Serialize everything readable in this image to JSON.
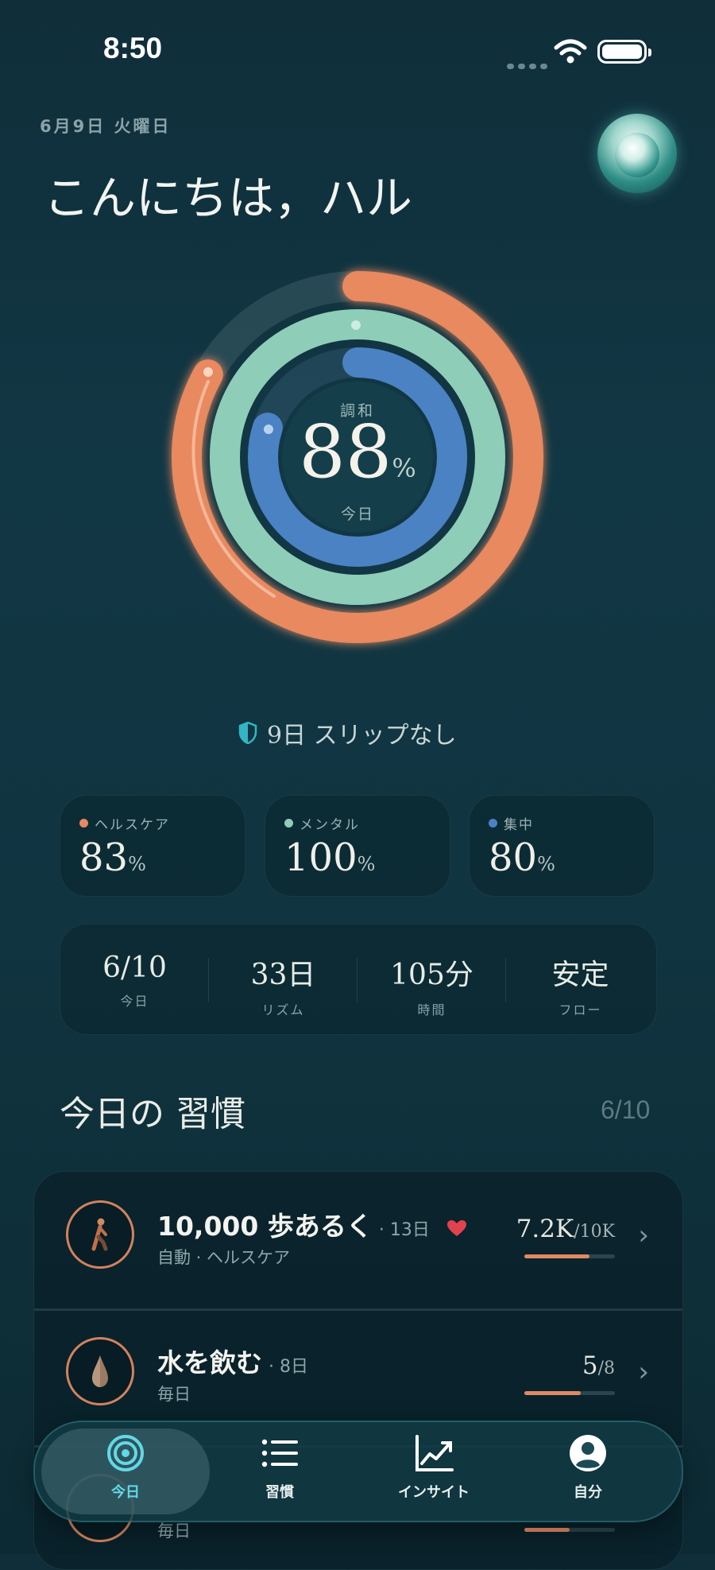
{
  "status": {
    "time": "8:50"
  },
  "header": {
    "date": "6月9日 火曜日",
    "greeting": "こんにちは，ハル"
  },
  "ring": {
    "label": "調和",
    "value": "88",
    "unit": "%",
    "sub": "今日",
    "health_pct": 83,
    "mental_pct": 100,
    "focus_pct": 80,
    "colors": {
      "health": "#e8895f",
      "mental": "#8ecdb8",
      "focus": "#4a82c3"
    }
  },
  "streak": {
    "text": "9日 スリップなし"
  },
  "stats": [
    {
      "label": "ヘルスケア",
      "value": "83",
      "unit": "%",
      "color": "#e8895f"
    },
    {
      "label": "メンタル",
      "value": "100",
      "unit": "%",
      "color": "#8ecdb8"
    },
    {
      "label": "集中",
      "value": "80",
      "unit": "%",
      "color": "#4a82c3"
    }
  ],
  "metrics": [
    {
      "value": "6/10",
      "label": "今日"
    },
    {
      "value": "33日",
      "label": "リズム"
    },
    {
      "value": "105分",
      "label": "時間"
    },
    {
      "value": "安定",
      "label": "フロー"
    }
  ],
  "habits_section": {
    "title": "今日の 習慣",
    "count": "6/10"
  },
  "habits": [
    {
      "title": "10,000 歩あるく",
      "days": "· 13日",
      "sub": "自動 · ヘルスケア",
      "progress": "7.2K",
      "total": "/10K",
      "fraction": 0.72,
      "icon": "walking-person-icon"
    },
    {
      "title": "水を飲む",
      "days": "· 8日",
      "sub": "毎日",
      "progress": "5",
      "total": "/8",
      "fraction": 0.625,
      "icon": "water-drop-icon"
    },
    {
      "title": "",
      "days": "",
      "sub": "毎日",
      "progress": "",
      "total": "",
      "fraction": 0.5,
      "icon": "habit-icon"
    }
  ],
  "tabs": [
    {
      "label": "今日",
      "icon": "target-icon",
      "active": true
    },
    {
      "label": "習慣",
      "icon": "list-icon",
      "active": false
    },
    {
      "label": "インサイト",
      "icon": "chart-icon",
      "active": false
    },
    {
      "label": "自分",
      "icon": "profile-icon",
      "active": false
    }
  ]
}
